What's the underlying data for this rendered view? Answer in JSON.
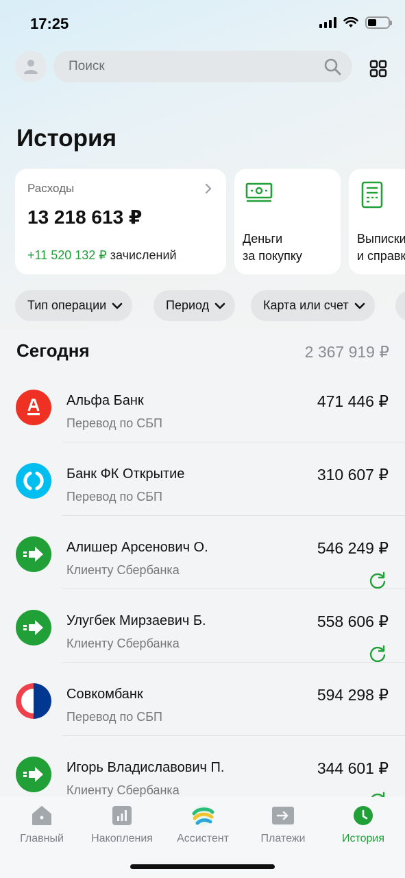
{
  "status_bar": {
    "time": "17:25"
  },
  "search": {
    "placeholder": "Поиск"
  },
  "page": {
    "title": "История"
  },
  "summary": {
    "expenses_label": "Расходы",
    "expenses_amount": "13 218 613 ₽",
    "income_amount": "+11 520 132 ₽",
    "income_label": "зачислений"
  },
  "shortcuts": [
    {
      "label": "Деньги\nза покупку",
      "icon": "cash-icon"
    },
    {
      "label": "Выписки\nи справки",
      "icon": "document-icon"
    }
  ],
  "filters": [
    "Тип операции",
    "Период",
    "Карта или счет"
  ],
  "section": {
    "title": "Сегодня",
    "total": "2 367 919 ₽"
  },
  "transactions": [
    {
      "name": "Альфа Банк",
      "subtitle": "Перевод по СБП",
      "amount": "471 446 ₽",
      "logo": "alfa-bank-logo",
      "repeat": false
    },
    {
      "name": "Банк ФК Открытие",
      "subtitle": "Перевод по СБП",
      "amount": "310 607 ₽",
      "logo": "otkritie-logo",
      "repeat": false
    },
    {
      "name": "Алишер Арсенович О.",
      "subtitle": "Клиенту Сбербанка",
      "amount": "546 249 ₽",
      "logo": "sber-transfer-logo",
      "repeat": true
    },
    {
      "name": "Улугбек Мирзаевич Б.",
      "subtitle": "Клиенту Сбербанка",
      "amount": "558 606 ₽",
      "logo": "sber-transfer-logo",
      "repeat": true
    },
    {
      "name": "Совкомбанк",
      "subtitle": "Перевод по СБП",
      "amount": "594 298 ₽",
      "logo": "sovcombank-logo",
      "repeat": false
    },
    {
      "name": "Игорь Владиславович П.",
      "subtitle": "Клиенту Сбербанка",
      "amount": "344 601 ₽",
      "logo": "sber-transfer-logo",
      "repeat": true
    }
  ],
  "tabs": [
    {
      "label": "Главный",
      "icon": "home-icon",
      "active": false
    },
    {
      "label": "Накопления",
      "icon": "savings-chart-icon",
      "active": false
    },
    {
      "label": "Ассистент",
      "icon": "assistant-icon",
      "active": false
    },
    {
      "label": "Платежи",
      "icon": "payments-icon",
      "active": false
    },
    {
      "label": "История",
      "icon": "history-icon",
      "active": true
    }
  ],
  "colors": {
    "accent_green": "#21a038",
    "alfa_red": "#ef3124",
    "otkritie_blue": "#00bef0",
    "sovcom_blue": "#003791",
    "sovcom_red": "#f0404b"
  }
}
